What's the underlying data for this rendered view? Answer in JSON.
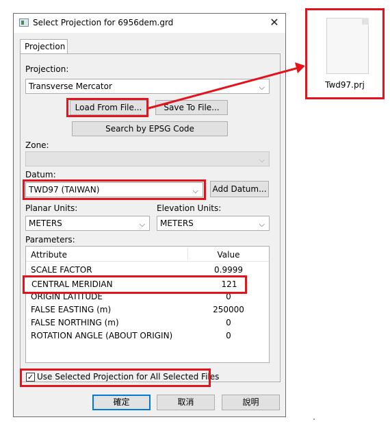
{
  "window": {
    "title": "Select Projection for 6956dem.grd",
    "close_glyph": "✕"
  },
  "tab": {
    "label": "Projection"
  },
  "projection": {
    "label": "Projection:",
    "value": "Transverse Mercator",
    "load_button": "Load From File...",
    "save_button": "Save To File...",
    "search_button": "Search by EPSG Code"
  },
  "zone": {
    "label": "Zone:",
    "value": ""
  },
  "datum": {
    "label": "Datum:",
    "value": "TWD97 (TAIWAN)",
    "add_button": "Add Datum..."
  },
  "units": {
    "planar_label": "Planar Units:",
    "planar_value": "METERS",
    "elevation_label": "Elevation Units:",
    "elevation_value": "METERS"
  },
  "parameters": {
    "label": "Parameters:",
    "columns": [
      "Attribute",
      "Value"
    ],
    "rows": [
      {
        "attribute": "SCALE FACTOR",
        "value": "0.9999"
      },
      {
        "attribute": "CENTRAL MERIDIAN",
        "value": "121"
      },
      {
        "attribute": "ORIGIN LATITUDE",
        "value": "0"
      },
      {
        "attribute": "FALSE EASTING (m)",
        "value": "250000"
      },
      {
        "attribute": "FALSE NORTHING (m)",
        "value": "0"
      },
      {
        "attribute": "ROTATION ANGLE (ABOUT ORIGIN)",
        "value": "0"
      }
    ]
  },
  "use_all": {
    "label": "Use Selected Projection for All Selected Files",
    "checked": true,
    "check_glyph": "✓"
  },
  "buttons": {
    "ok": "確定",
    "cancel": "取消",
    "help": "說明"
  },
  "file": {
    "name": "Twd97.prj",
    "icon": "document-icon"
  },
  "colors": {
    "highlight": "#e3121b",
    "dialog_bg": "#f0f0f0"
  }
}
